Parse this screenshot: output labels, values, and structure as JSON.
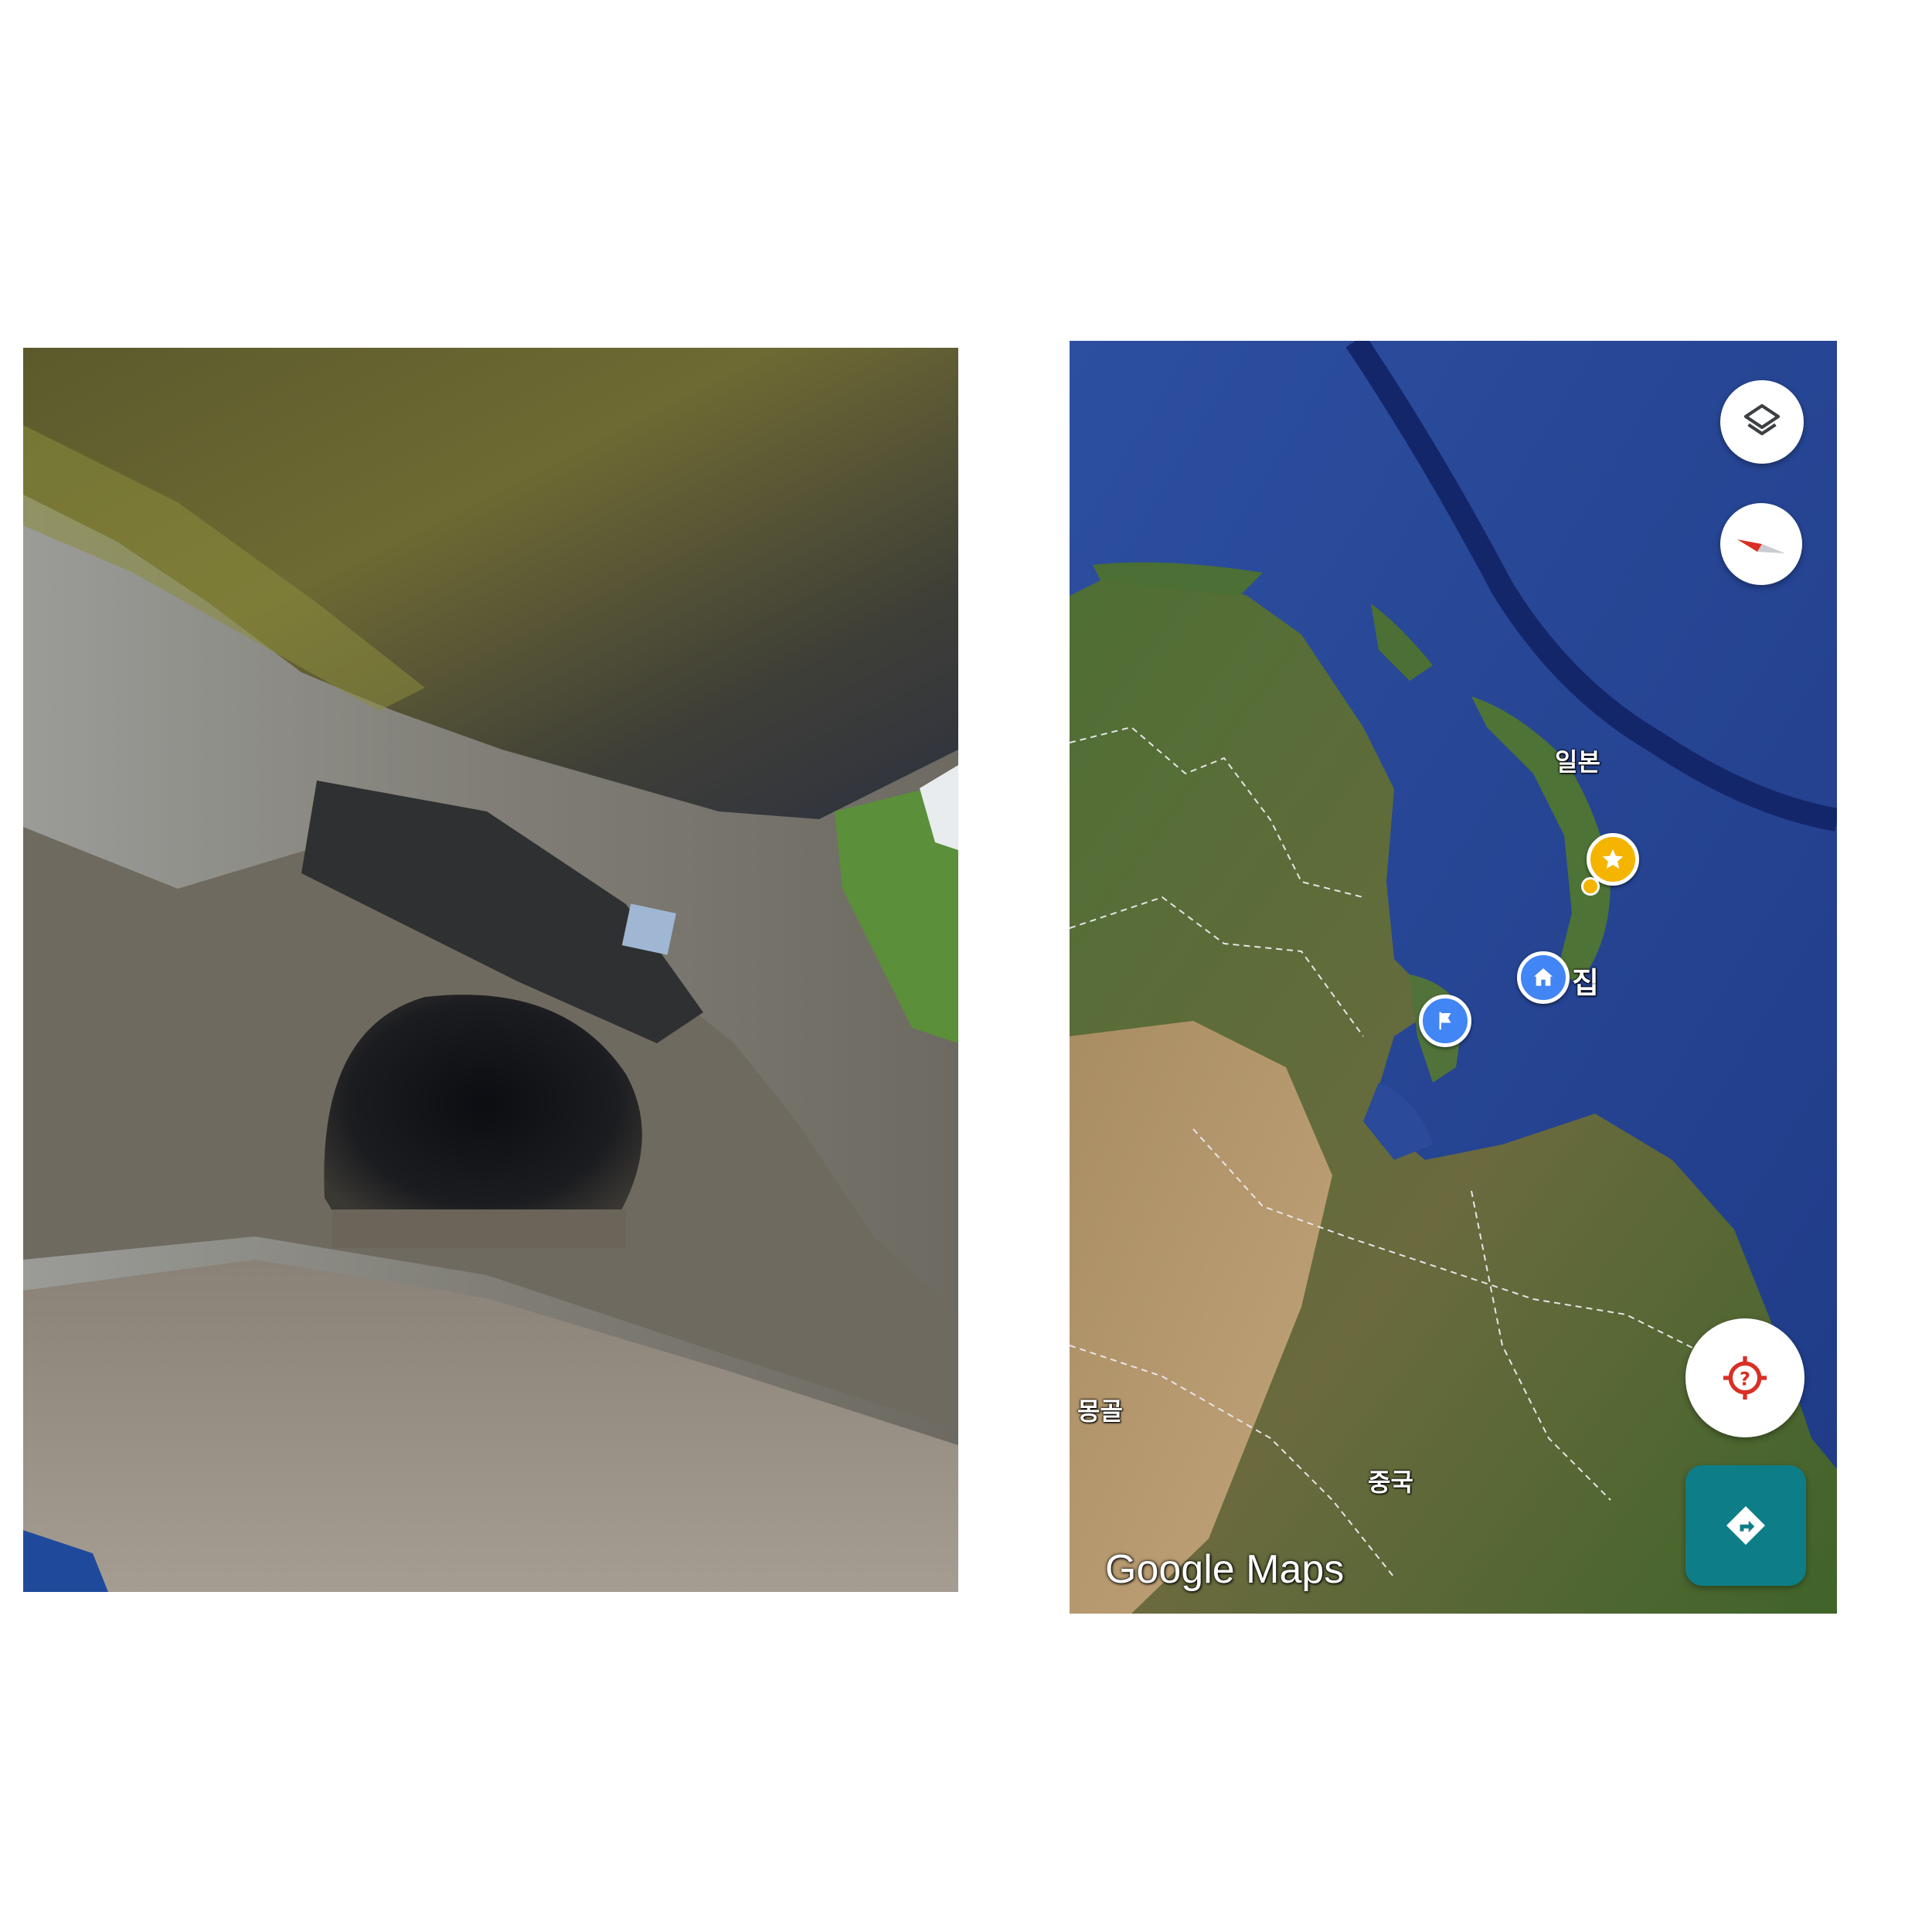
{
  "photo": {
    "subject": "rock-cave-entrance"
  },
  "map": {
    "labels": {
      "japan": "일본",
      "home": "집",
      "mongolia": "몽골",
      "china": "중국"
    },
    "brand": "Google Maps",
    "controls": {
      "layers_icon": "layers-icon",
      "compass_icon": "compass-icon",
      "locate_icon": "locate-unknown-icon",
      "directions_icon": "directions-icon"
    },
    "pins": {
      "starred_icon": "star-icon",
      "home_icon": "home-icon",
      "flag_icon": "flag-icon"
    },
    "colors": {
      "ocean": "#2b4a9a",
      "land": "#4f6e35",
      "pin_blue": "#4285f4",
      "pin_yellow": "#f4b400",
      "directions_teal": "#0d7e88",
      "locate_red": "#d93025"
    }
  }
}
